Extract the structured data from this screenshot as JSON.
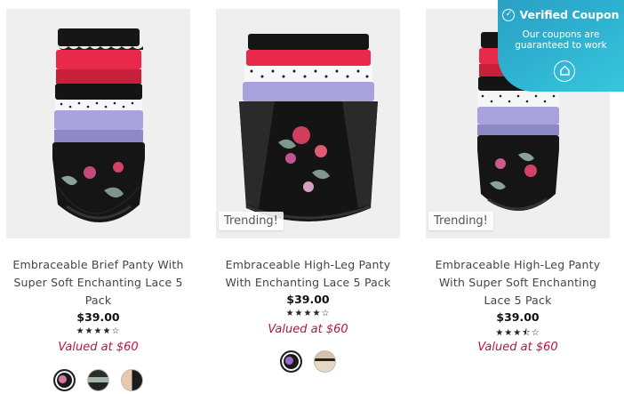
{
  "products": [
    {
      "name": "Embraceable Brief Panty With Super Soft Enchanting Lace 5 Pack",
      "price": "$39.00",
      "rating": 4,
      "stars_text": "★★★★☆",
      "valued": "Valued at $60",
      "trending": "",
      "swatches": [
        "black-floral",
        "black-sage",
        "beige-black"
      ]
    },
    {
      "name": "Embraceable High-Leg Panty With Enchanting Lace 5 Pack",
      "price": "$39.00",
      "rating": 4,
      "stars_text": "★★★★☆",
      "valued": "Valued at $60",
      "trending": "Trending!",
      "swatches": [
        "black-floral",
        "nude-stripe"
      ]
    },
    {
      "name": "Embraceable High-Leg Panty With Super Soft Enchanting Lace 5 Pack",
      "price": "$39.00",
      "rating": 3.5,
      "stars_text": "★★★⯪☆",
      "valued": "Valued at $60",
      "trending": "Trending!",
      "swatches": []
    }
  ],
  "verified_coupon": {
    "title": "Verified Coupon",
    "text_line1": "Our coupons are",
    "text_line2": "guaranteed to work",
    "check_icon": "check-circle-icon",
    "badge_icon": "tag-badge-icon"
  },
  "colors": {
    "accent_red": "#b5163b",
    "coupon_teal": "#2fb4d2",
    "panty_red": "#e8294a",
    "panty_lavender": "#a8a3dc",
    "panty_black": "#111111"
  }
}
